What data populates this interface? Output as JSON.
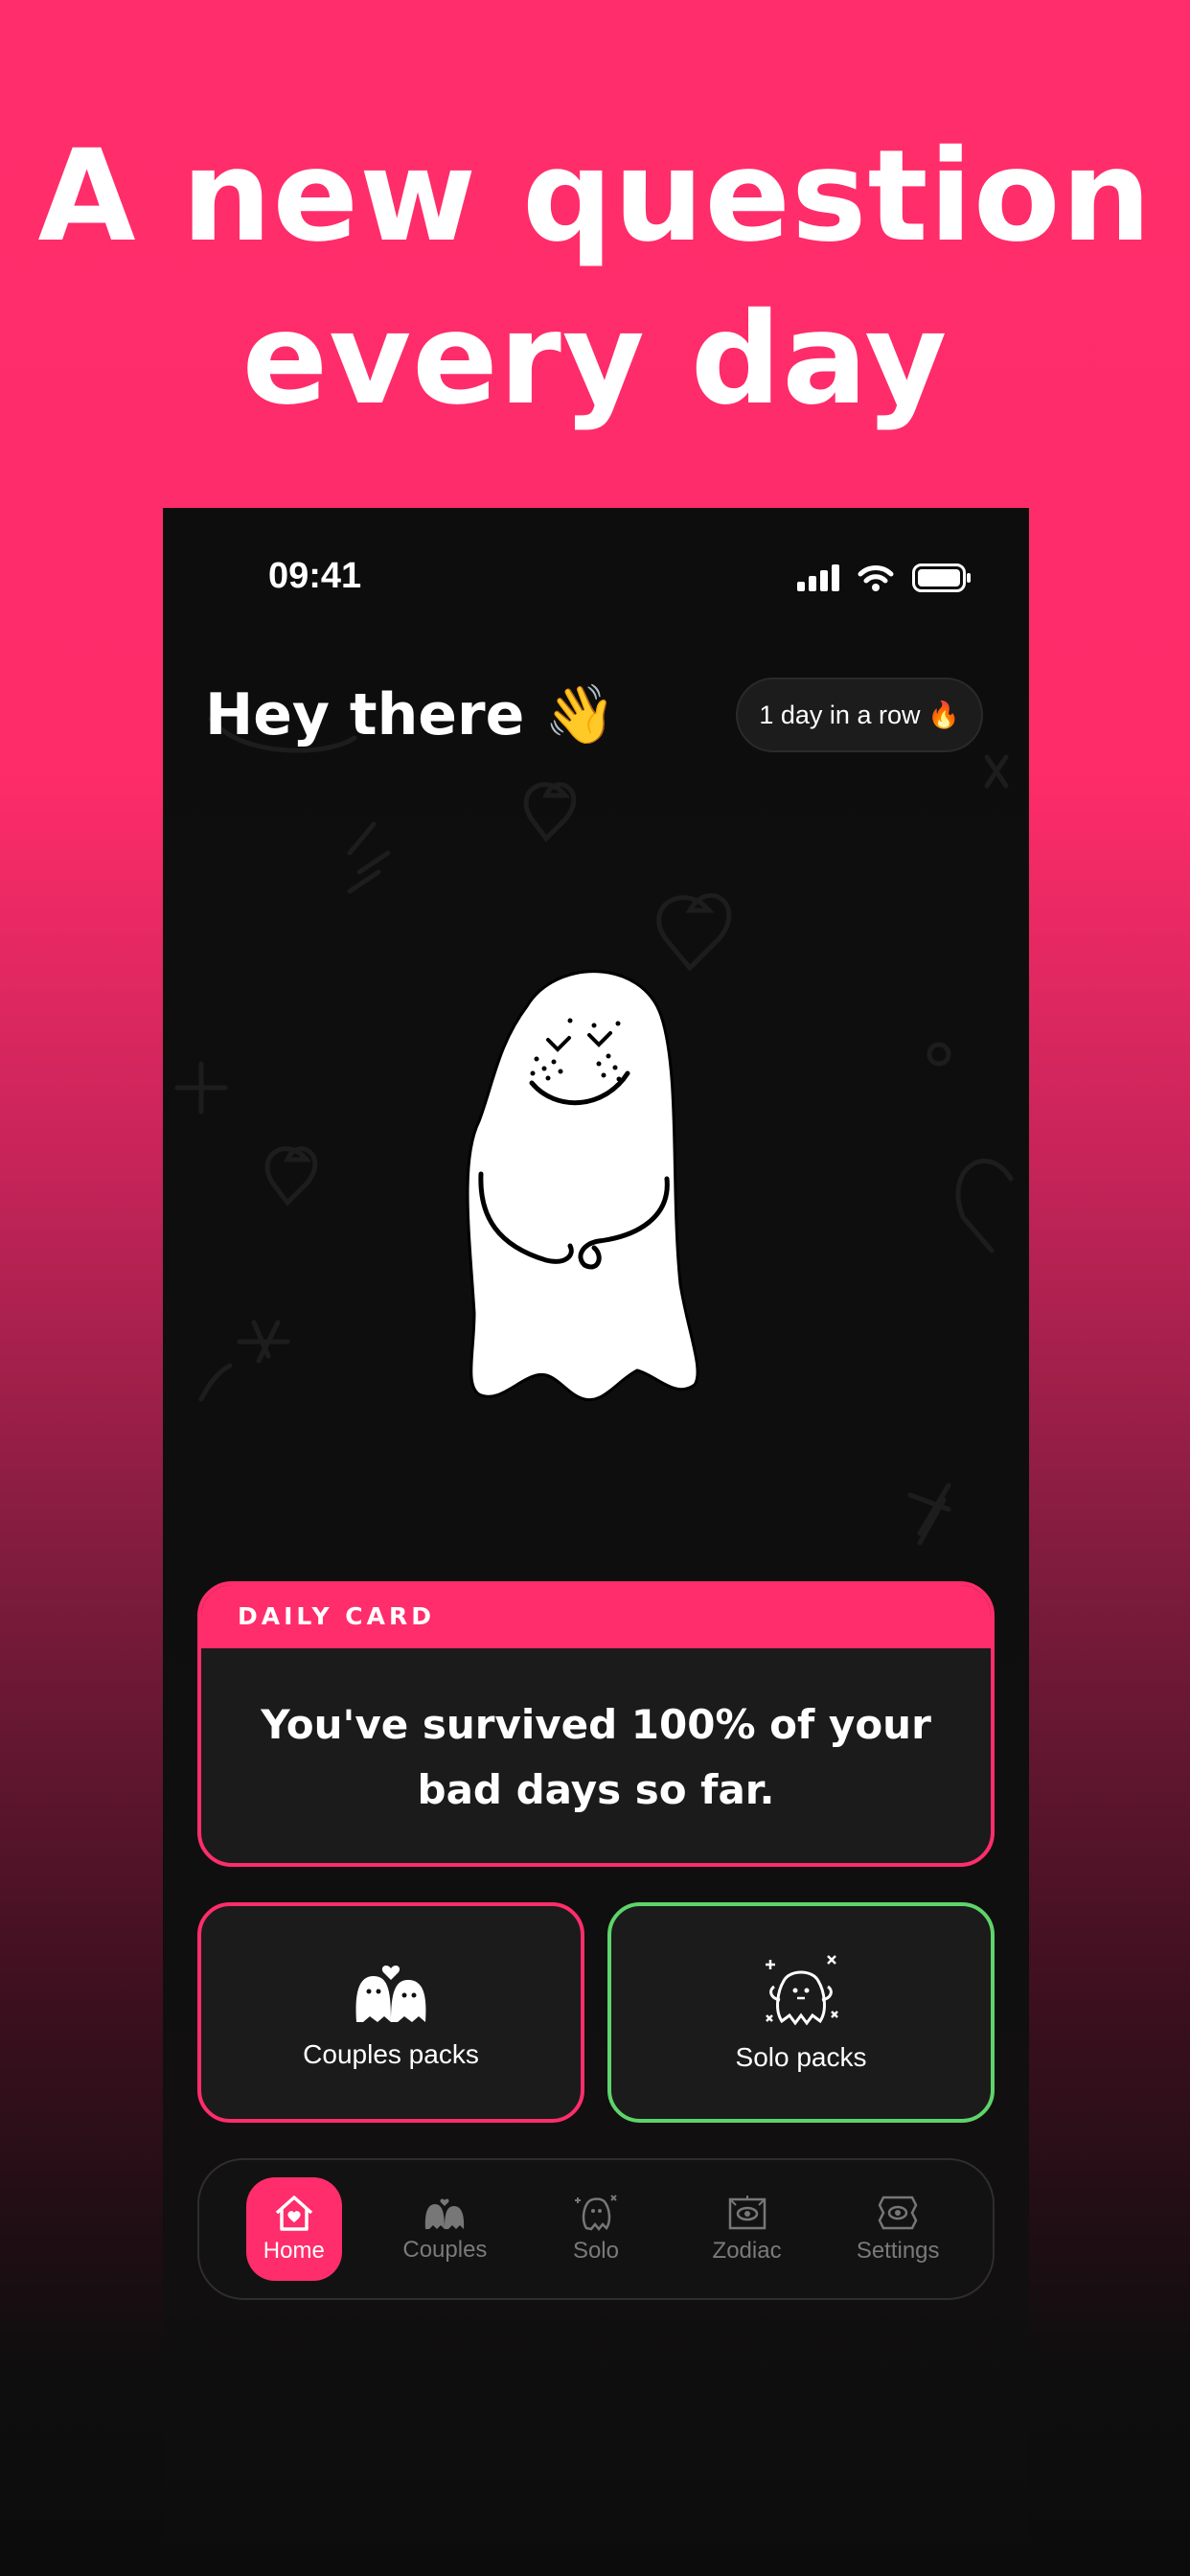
{
  "headline": {
    "line1": "A new question",
    "line2": "every day"
  },
  "status": {
    "time": "09:41",
    "icons": [
      "signal-icon",
      "wifi-icon",
      "battery-icon"
    ]
  },
  "greeting": {
    "text": "Hey there",
    "emoji": "👋"
  },
  "streak": {
    "label": "1 day in a row",
    "emoji": "🔥"
  },
  "daily_card": {
    "header": "DAILY CARD",
    "text": "You've survived 100% of your bad days so far."
  },
  "packs": {
    "couples": {
      "label": "Couples packs",
      "icon": "ghost-couple-icon"
    },
    "solo": {
      "label": "Solo packs",
      "icon": "ghost-solo-icon"
    }
  },
  "tabs": [
    {
      "label": "Home",
      "icon": "home-icon",
      "active": true
    },
    {
      "label": "Couples",
      "icon": "couples-icon",
      "active": false
    },
    {
      "label": "Solo",
      "icon": "solo-icon",
      "active": false
    },
    {
      "label": "Zodiac",
      "icon": "zodiac-icon",
      "active": false
    },
    {
      "label": "Settings",
      "icon": "settings-icon",
      "active": false
    }
  ],
  "colors": {
    "accent": "#ff2d6b",
    "solo_accent": "#5ed46a",
    "background": "#0d0d0d"
  }
}
